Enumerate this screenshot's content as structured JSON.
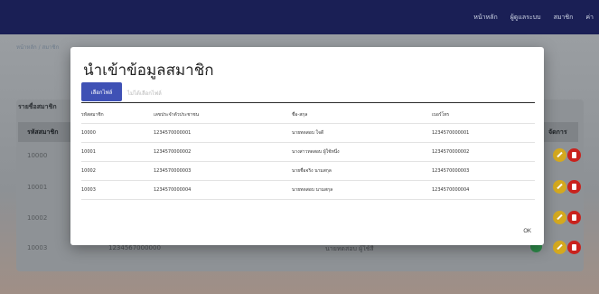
{
  "topnav": {
    "items": [
      "หน้าหลัก",
      "ผู้ดูแลระบบ",
      "สมาชิก",
      "ค่า"
    ]
  },
  "background": {
    "breadcrumb": "หน้าหลัก  /  สมาชิก",
    "card_title": "รายชื่อสมาชิก",
    "col_member_id": "รหัสสมาชิก",
    "col_manage": "จัดการ",
    "rows": [
      "10000",
      "10001",
      "10002",
      "10003"
    ],
    "last_row_phone": "1234567000000",
    "last_row_name": "นายทดสอบ ผู้ใช้สี่"
  },
  "modal": {
    "title": "นำเข้าข้อมูลสมาชิก",
    "choose_file": "เลือกไฟล์",
    "file_placeholder": "ไม่ได้เลือกไฟล์",
    "headers": [
      "รหัสสมาชิก",
      "เลขประจำตัวประชาชน",
      "ชื่อ-สกุล",
      "เบอร์โทร"
    ],
    "rows": [
      [
        "10000",
        "1234570000001",
        "นายทดสอบ ใจดี",
        "1234570000001"
      ],
      [
        "10001",
        "1234570000002",
        "นางสาวทดสอบ ผู้ใช้หนึ่ง",
        "1234570000002"
      ],
      [
        "10002",
        "1234570000003",
        "นายชื่อจริง นามสกุล",
        "1234570000003"
      ],
      [
        "10003",
        "1234570000004",
        "นายทดสอบ นามสกุล",
        "1234570000004"
      ]
    ],
    "ok": "OK"
  },
  "colors": {
    "navbar": "#1a1f55",
    "primary_button": "#3f51b5",
    "edit": "#d4a91f",
    "delete": "#c9221d"
  }
}
